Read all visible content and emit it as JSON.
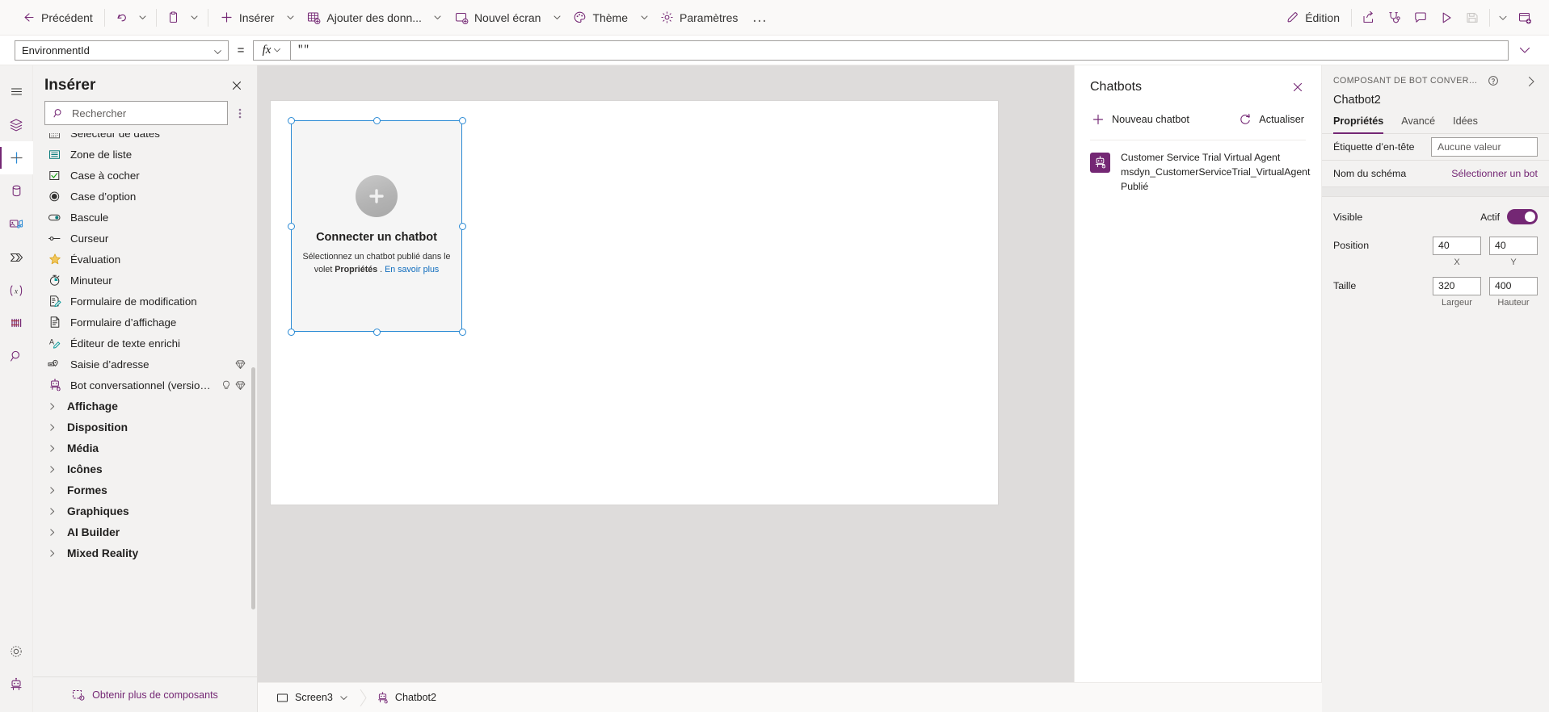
{
  "commandbar": {
    "back_label": "Précédent",
    "undo_icon": "undo-icon",
    "undo_caret": "chevron-down-icon",
    "paste_icon": "clipboard-icon",
    "paste_caret": "chevron-down-icon",
    "insert_label": "Insérer",
    "adddata_label": "Ajouter des donn...",
    "newscreen_label": "Nouvel écran",
    "theme_label": "Thème",
    "settings_label": "Paramètres",
    "overflow_label": "…",
    "edit_label": "Édition",
    "share_icon": "share-icon",
    "checker_icon": "app-checker-icon",
    "comments_icon": "comment-icon",
    "preview_icon": "play-icon",
    "save_icon": "save-icon",
    "save_caret": "chevron-down-icon",
    "publish_icon": "publish-icon"
  },
  "formulabar": {
    "property": "EnvironmentId",
    "equals": "=",
    "fx": "fx",
    "value": "\"\"",
    "expand_icon": "chevron-down-icon"
  },
  "rail": {
    "items": [
      {
        "name": "hamburger-icon",
        "label": "Menu"
      },
      {
        "name": "tree-view-icon",
        "label": "Arborescence"
      },
      {
        "name": "insert-plus-icon",
        "label": "Insérer"
      },
      {
        "name": "data-icon",
        "label": "Données"
      },
      {
        "name": "media-icon",
        "label": "Média"
      },
      {
        "name": "power-automate-icon",
        "label": "Power Automate"
      },
      {
        "name": "variables-icon",
        "label": "Variables"
      },
      {
        "name": "monitor-icon",
        "label": "Moniteur"
      },
      {
        "name": "search-icon",
        "label": "Rechercher"
      }
    ],
    "bottom": [
      {
        "name": "gear-icon",
        "label": "Paramètres"
      },
      {
        "name": "copilot-bot-icon",
        "label": "Copilot"
      }
    ]
  },
  "insert_panel": {
    "title": "Insérer",
    "close_icon": "close-icon",
    "search_placeholder": "Rechercher",
    "search_value": "",
    "more_icon": "more-vertical-icon",
    "items": [
      {
        "label": "Sélecteur de dates",
        "icon": "date-picker-icon",
        "premium": false,
        "preview": false
      },
      {
        "label": "Zone de liste",
        "icon": "list-box-icon",
        "premium": false,
        "preview": false
      },
      {
        "label": "Case à cocher",
        "icon": "checkbox-icon",
        "premium": false,
        "preview": false
      },
      {
        "label": "Case d’option",
        "icon": "radio-icon",
        "premium": false,
        "preview": false
      },
      {
        "label": "Bascule",
        "icon": "toggle-icon",
        "premium": false,
        "preview": false
      },
      {
        "label": "Curseur",
        "icon": "slider-icon",
        "premium": false,
        "preview": false
      },
      {
        "label": "Évaluation",
        "icon": "rating-star-icon",
        "premium": false,
        "preview": false
      },
      {
        "label": "Minuteur",
        "icon": "timer-icon",
        "premium": false,
        "preview": false
      },
      {
        "label": "Formulaire de modification",
        "icon": "edit-form-icon",
        "premium": false,
        "preview": false
      },
      {
        "label": "Formulaire d’affichage",
        "icon": "display-form-icon",
        "premium": false,
        "preview": false
      },
      {
        "label": "Éditeur de texte enrichi",
        "icon": "rich-text-editor-icon",
        "premium": false,
        "preview": false
      },
      {
        "label": "Saisie d’adresse",
        "icon": "address-input-icon",
        "premium": true,
        "preview": false
      },
      {
        "label": "Bot conversationnel (version p...",
        "icon": "chatbot-icon",
        "premium": true,
        "preview": true
      }
    ],
    "categories": [
      {
        "label": "Affichage"
      },
      {
        "label": "Disposition"
      },
      {
        "label": "Média"
      },
      {
        "label": "Icônes"
      },
      {
        "label": "Formes"
      },
      {
        "label": "Graphiques"
      },
      {
        "label": "AI Builder"
      },
      {
        "label": "Mixed Reality"
      }
    ],
    "footer_label": "Obtenir plus de composants",
    "footer_icon": "get-components-icon"
  },
  "canvas": {
    "control": {
      "plus_icon": "plus-circle-icon",
      "title": "Connecter un chatbot",
      "desc_part1": "Sélectionnez un chatbot publié dans le volet ",
      "desc_bold": "Propriétés",
      "desc_part2": " .",
      "link": "En savoir plus"
    }
  },
  "chatbots_panel": {
    "title": "Chatbots",
    "close_icon": "close-icon",
    "new_label": "Nouveau chatbot",
    "new_icon": "plus-icon",
    "refresh_label": "Actualiser",
    "refresh_icon": "refresh-icon",
    "bots": [
      {
        "icon": "bot-avatar-icon",
        "display_name": "Customer Service Trial Virtual Agent",
        "schema_name": "msdyn_CustomerServiceTrial_VirtualAgent",
        "status": "Publié"
      }
    ]
  },
  "properties_panel": {
    "caption": "COMPOSANT DE BOT CONVERSATIONN...",
    "help_icon": "help-circle-icon",
    "collapse_icon": "chevron-right-icon",
    "control_name": "Chatbot2",
    "tabs": [
      {
        "label": "Propriétés",
        "active": true
      },
      {
        "label": "Avancé",
        "active": false
      },
      {
        "label": "Idées",
        "active": false
      }
    ],
    "rows": [
      {
        "label": "Étiquette d’en-tête",
        "value": "Aucune valeur",
        "kind": "input"
      },
      {
        "label": "Nom du schéma",
        "value": "Sélectionner un bot",
        "kind": "link"
      }
    ],
    "visible": {
      "label": "Visible",
      "state": "Actif",
      "on": true
    },
    "position": {
      "label": "Position",
      "x": "40",
      "y": "40",
      "x_sub": "X",
      "y_sub": "Y"
    },
    "size": {
      "label": "Taille",
      "width": "320",
      "height": "400",
      "width_sub": "Largeur",
      "height_sub": "Hauteur"
    }
  },
  "bottombar": {
    "screen_label": "Screen3",
    "screen_icon": "screen-icon",
    "screen_caret": "chevron-down-icon",
    "control_label": "Chatbot2",
    "control_icon": "chatbot-icon"
  },
  "colors": {
    "brand": "#742774",
    "accent_link": "#0f6cbd",
    "selection": "#2a8ad4",
    "panel_bg": "#f3f2f1",
    "canvas_bg": "#dedcdb"
  }
}
